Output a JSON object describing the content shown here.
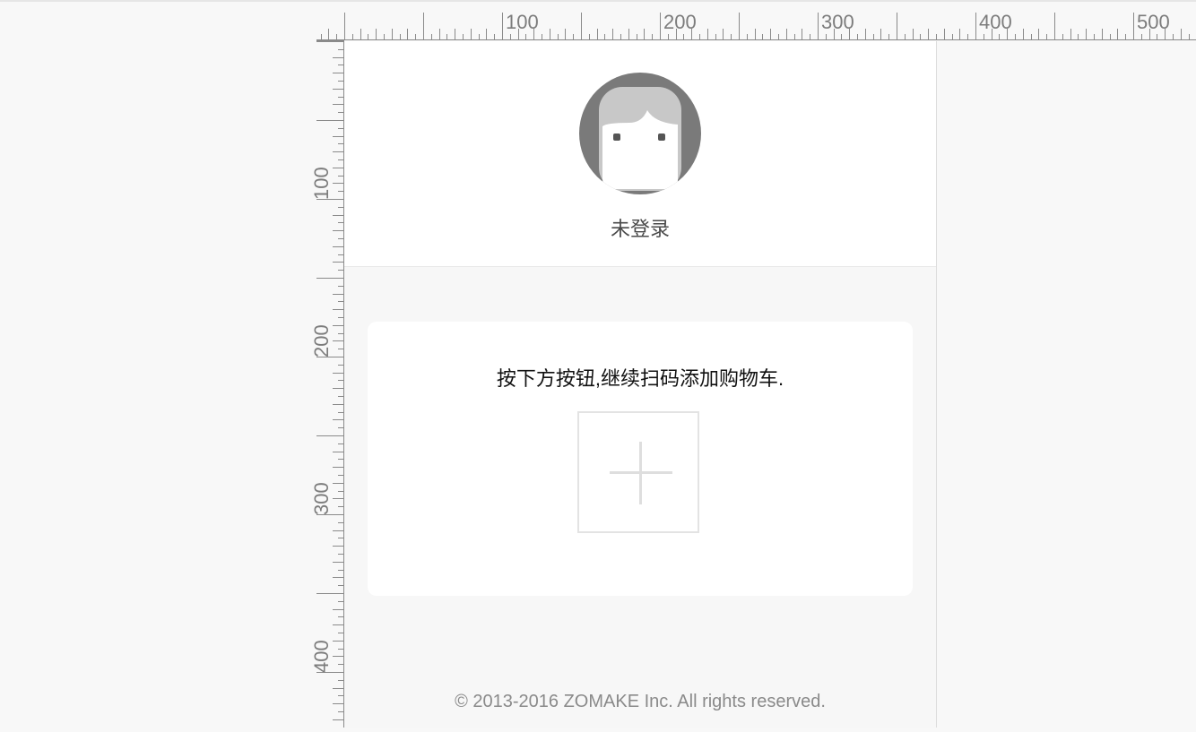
{
  "ruler": {
    "horizontal_labels": [
      "100",
      "200",
      "300",
      "400",
      "500"
    ],
    "vertical_labels": [
      "100",
      "200",
      "300",
      "400"
    ]
  },
  "profile": {
    "status_text": "未登录",
    "avatar_icon": "default-avatar-icon"
  },
  "scan_card": {
    "hint": "按下方按钮,继续扫码添加购物车.",
    "add_button_icon": "plus-icon"
  },
  "footer": {
    "copyright": "© 2013-2016 ZOMAKE Inc. All rights reserved."
  },
  "colors": {
    "page_bg": "#f8f8f8",
    "card_bg": "#ffffff",
    "avatar_dark": "#7a7a7a",
    "avatar_light": "#c8c8c8"
  }
}
